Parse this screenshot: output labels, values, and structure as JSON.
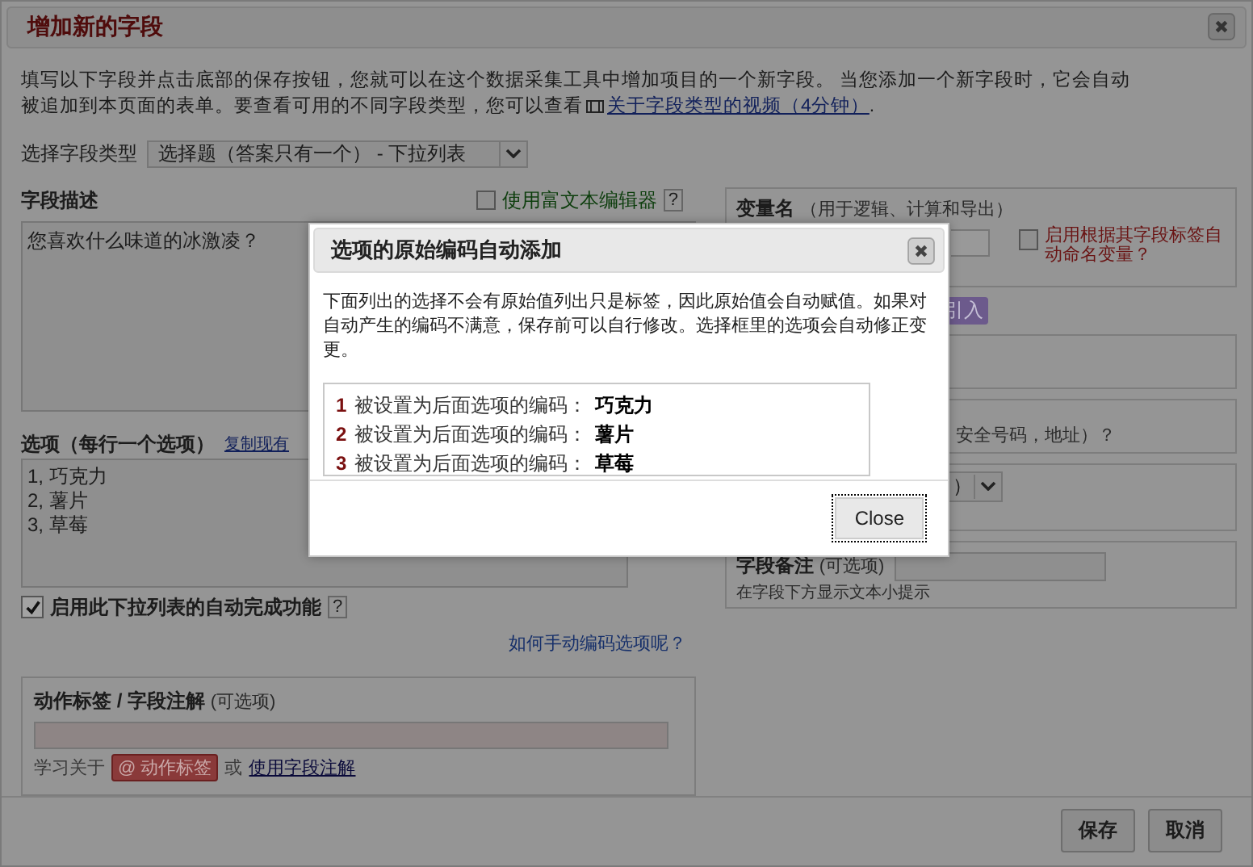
{
  "dialog": {
    "title": "增加新的字段"
  },
  "intro": {
    "text": "填写以下字段并点击底部的保存按钮，您就可以在这个数据采集工具中增加项目的一个新字段。 当您添加一个新字段时，它会自动被追加到本页面的表单。要查看可用的不同字段类型，您可以查看",
    "video_link": "关于字段类型的视频（4分钟）",
    "end": "."
  },
  "field_type": {
    "label": "选择字段类型",
    "value": "选择题（答案只有一个） - 下拉列表"
  },
  "description": {
    "label": "字段描述",
    "rich_text": {
      "label": "使用富文本编辑器",
      "checked": false
    },
    "help": "?",
    "value": "您喜欢什么味道的冰激凌？"
  },
  "choices": {
    "label": "选项（每行一个选项）",
    "copy_link": "复制现有",
    "value": "1, 巧克力\n2, 薯片\n3, 草莓"
  },
  "autocomplete": {
    "label": "启用此下拉列表的自动完成功能",
    "checked": true,
    "help": "?"
  },
  "manual_code_link": "如何手动编码选项呢？",
  "action_tags": {
    "label": "动作标签 / 字段注解",
    "optional": "(可选项)",
    "learn": "学习关于",
    "tag_badge": "@ 动作标签",
    "or": "或",
    "notes_link": "使用字段注解"
  },
  "variable": {
    "label": "变量名",
    "hint": "（用于逻辑、计算和导出）",
    "auto_name": {
      "label": "启用根据其字段标签自动命名变量？",
      "checked": false
    }
  },
  "import_badge": "引入",
  "identifier_fragment": "安全号码，地址）？",
  "fragment_select": {
    "value": "）"
  },
  "field_note": {
    "label": "字段备注",
    "optional": "(可选项)",
    "hint": "在字段下方显示文本小提示"
  },
  "buttons": [
    {
      "label": "保存"
    },
    {
      "label": "取消"
    }
  ],
  "modal": {
    "title": "选项的原始编码自动添加",
    "message": "下面列出的选择不会有原始值列出只是标签，因此原始值会自动赋值。如果对自动产生的编码不满意，保存前可以自行修改。选择框里的选项会自动修正变更。",
    "codes": [
      {
        "code": "1",
        "text": "被设置为后面选项的编码：",
        "choice": "巧克力"
      },
      {
        "code": "2",
        "text": "被设置为后面选项的编码：",
        "choice": "薯片"
      },
      {
        "code": "3",
        "text": "被设置为后面选项的编码：",
        "choice": "草莓"
      }
    ],
    "close_button": "Close"
  }
}
